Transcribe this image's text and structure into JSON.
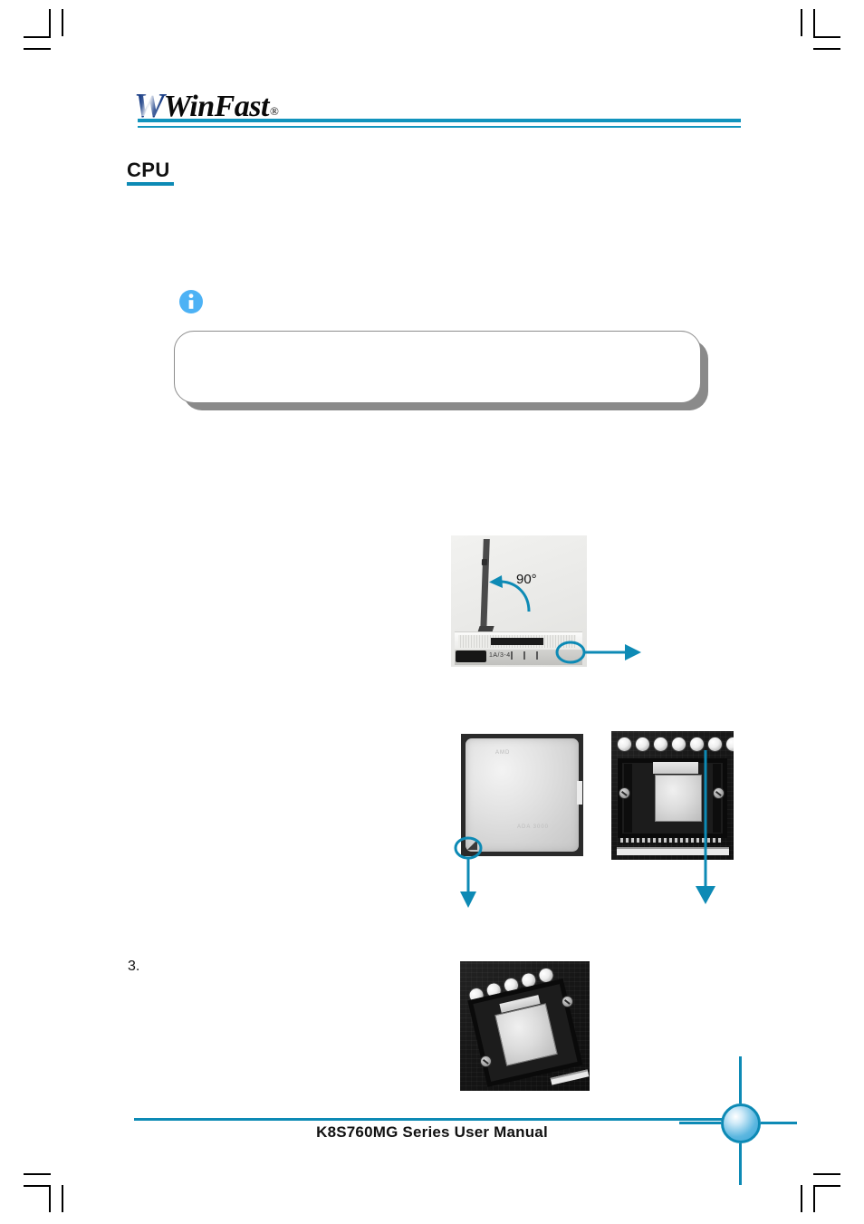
{
  "document": {
    "brand_logo": {
      "mark": "W",
      "name": "WinFast",
      "registered": "®"
    },
    "section_heading": "CPU",
    "intro_text": "",
    "after_note_text": "",
    "note": {
      "icon": "info-icon",
      "text": ""
    },
    "steps": [
      {
        "number": "3.",
        "text": ""
      }
    ],
    "figures": [
      {
        "id": "socket-lever",
        "caption": "",
        "angle_label": "90°",
        "socket_marking": "1A/3-4",
        "annotations": [
          {
            "type": "rotation-arrow",
            "color": "#0d8ab5"
          },
          {
            "type": "circle-callout",
            "color": "#0d8ab5"
          },
          {
            "type": "arrow-right",
            "color": "#0d8ab5"
          }
        ]
      },
      {
        "id": "cpu-chip",
        "caption": "",
        "chip_mark_top": "AMD",
        "chip_mark_bottom": "ADA 3000",
        "annotations": [
          {
            "type": "circle-callout",
            "color": "#0d8ab5"
          },
          {
            "type": "arrow-down",
            "color": "#0d8ab5"
          }
        ]
      },
      {
        "id": "board-socket-installed",
        "caption": "",
        "annotations": [
          {
            "type": "arrow-down",
            "color": "#0d8ab5"
          }
        ]
      },
      {
        "id": "board-socket-installed-closeup",
        "caption": "",
        "annotations": []
      }
    ],
    "footer": {
      "title": "K8S760MG Series User Manual",
      "page_number": ""
    },
    "colors": {
      "accent_teal": "#0d8ab5",
      "rule_teal": "#1194bd",
      "logo_blue": "#1b3f87",
      "info_blue": "#4db2f5",
      "note_shadow_gray": "#8a8a8a"
    }
  }
}
